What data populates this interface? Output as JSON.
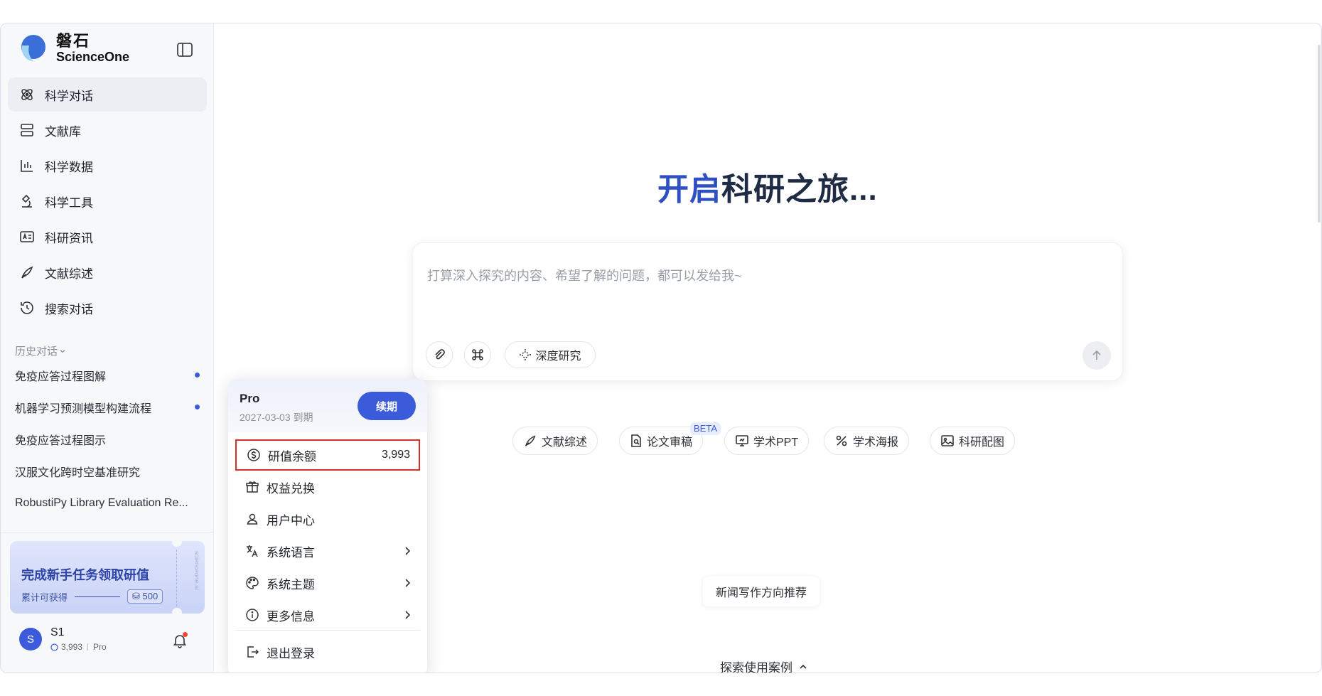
{
  "brand": {
    "name_cn": "磐石",
    "name_en": "ScienceOne"
  },
  "nav": {
    "items": [
      {
        "label": "科学对话",
        "icon": "atom-icon",
        "active": true
      },
      {
        "label": "文献库",
        "icon": "library-icon"
      },
      {
        "label": "科学数据",
        "icon": "data-chart-icon"
      },
      {
        "label": "科学工具",
        "icon": "microscope-icon"
      },
      {
        "label": "科研资讯",
        "icon": "news-icon"
      },
      {
        "label": "文献综述",
        "icon": "pen-icon"
      },
      {
        "label": "搜索对话",
        "icon": "history-icon"
      }
    ]
  },
  "history": {
    "title": "历史对话",
    "items": [
      {
        "label": "免疫应答过程图解",
        "unread": true
      },
      {
        "label": "机器学习预测模型构建流程",
        "unread": true
      },
      {
        "label": "免疫应答过程图示",
        "unread": false
      },
      {
        "label": "汉服文化跨时空基准研究",
        "unread": false
      },
      {
        "label": "RobustiPy Library Evaluation Re...",
        "unread": false
      }
    ]
  },
  "promo": {
    "title": "完成新手任务领取研值",
    "subtitle": "累计可获得",
    "amount": "500",
    "vertical_text": "scienceone.ai"
  },
  "user": {
    "initial": "S",
    "name": "S1",
    "balance": "3,993",
    "plan": "Pro"
  },
  "main": {
    "hero": {
      "part1": "开启",
      "part2": "科研之旅..."
    },
    "composer": {
      "placeholder": "打算深入探究的内容、希望了解的问题，都可以发给我~",
      "deep_research_label": "深度研究"
    },
    "tools": [
      {
        "label": "文献综述",
        "icon": "pen-icon"
      },
      {
        "label": "论文审稿",
        "icon": "doc-search-icon"
      },
      {
        "label": "学术PPT",
        "icon": "presentation-icon"
      },
      {
        "label": "学术海报",
        "icon": "poster-icon"
      },
      {
        "label": "科研配图",
        "icon": "image-icon"
      }
    ],
    "beta_label": "BETA",
    "suggestion": "新闻写作方向推荐",
    "explore_label": "探索使用案例"
  },
  "popup": {
    "plan": "Pro",
    "expire": "2027-03-03 到期",
    "renew_label": "续期",
    "items": [
      {
        "label": "研值余额",
        "value": "3,993",
        "icon": "coin-icon"
      },
      {
        "label": "权益兑换",
        "icon": "gift-icon"
      },
      {
        "label": "用户中心",
        "icon": "user-icon"
      },
      {
        "label": "系统语言",
        "icon": "translate-icon"
      },
      {
        "label": "系统主题",
        "icon": "palette-icon"
      },
      {
        "label": "更多信息",
        "icon": "info-icon"
      }
    ],
    "logout_label": "退出登录"
  },
  "colors": {
    "accent": "#3b5bdb",
    "hero_blue": "#2f4fc4",
    "highlight_border": "#d9302c",
    "unread_dot": "#3b5bdb"
  }
}
